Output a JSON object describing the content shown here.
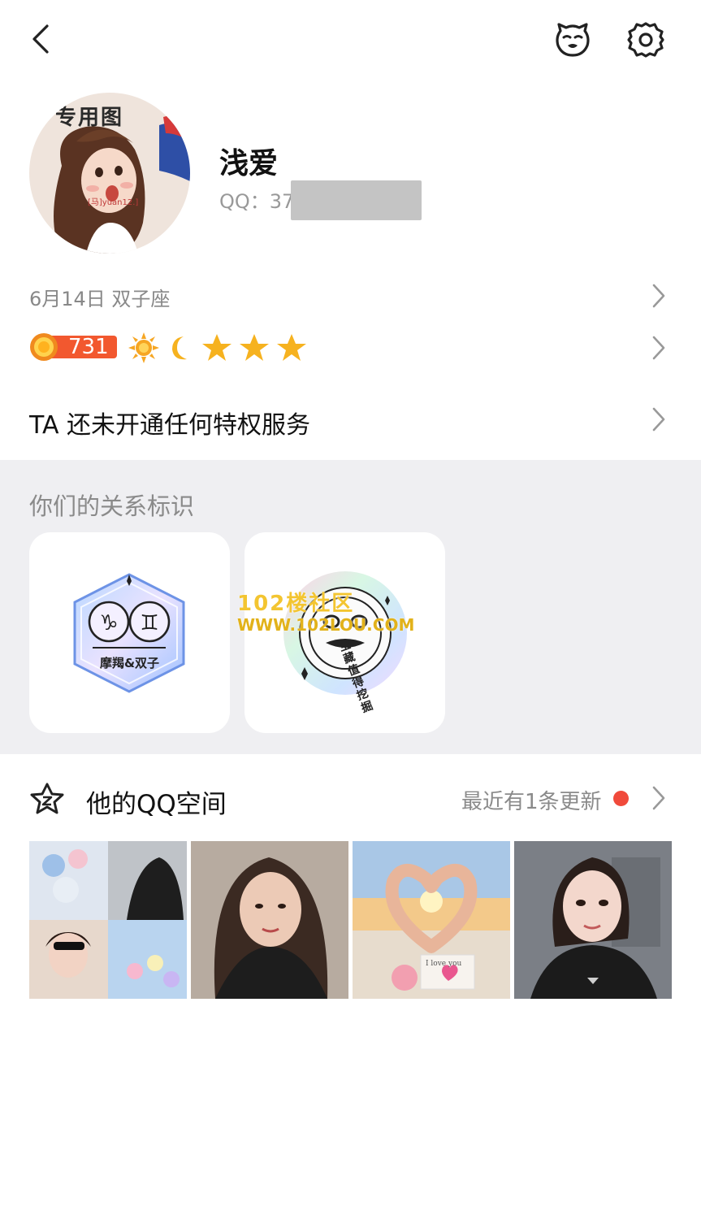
{
  "profile": {
    "nickname": "浅爱",
    "qq_prefix": "QQ：37",
    "avatar_caption": "专用图",
    "avatar_mark": "[马]yuan12.]"
  },
  "birthday": "6月14日 双子座",
  "level": {
    "badge_number": "731",
    "icons": [
      "sun-icon",
      "moon-icon",
      "star-icon",
      "star-icon",
      "star-icon"
    ]
  },
  "privilege": "TA 还未开通任何特权服务",
  "relation": {
    "title": "你们的关系标识",
    "cards": [
      {
        "label": "摩羯&双子",
        "icon": "zodiac-hexagon-icon"
      },
      {
        "ring_text": "宝藏值得挖掘",
        "icon": "treasure-badge-icon"
      }
    ]
  },
  "watermark": {
    "line1": "102楼社区",
    "line2": "WWW.102LOU.COM"
  },
  "zone": {
    "title": "他的QQ空间",
    "update_text": "最近有1条更新",
    "photos": [
      {
        "name": "photo-collage"
      },
      {
        "name": "photo-woman-selfie"
      },
      {
        "name": "photo-heart-hands-sunset",
        "note_text": "I love you"
      },
      {
        "name": "photo-woman-black-shirt"
      }
    ]
  },
  "colors": {
    "accent_red": "#f04a3b",
    "section_bg": "#efeff2",
    "muted_text": "#888888"
  }
}
